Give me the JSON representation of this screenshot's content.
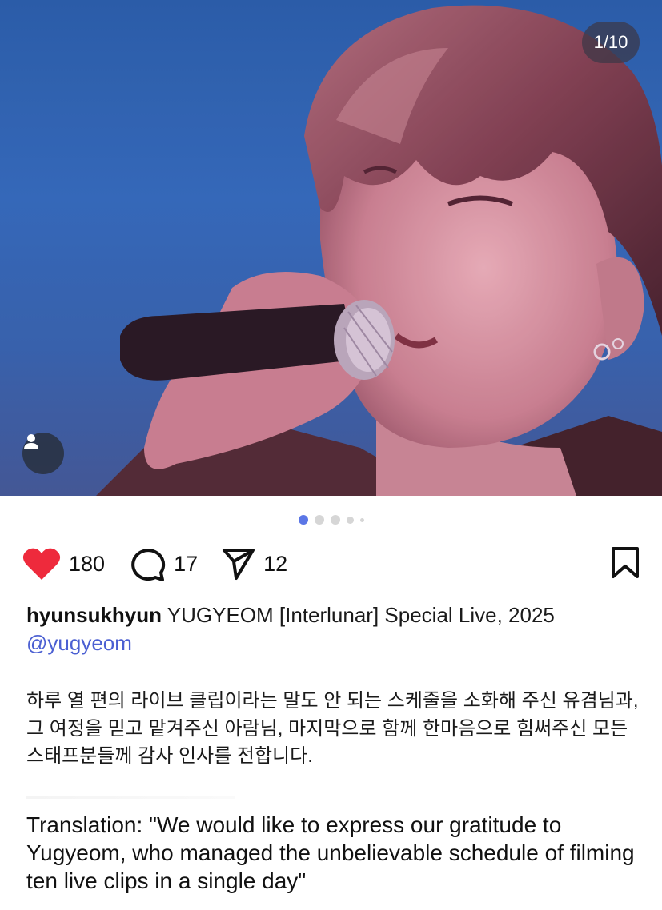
{
  "photo": {
    "description_icon": "user-icon",
    "counter": "1/10"
  },
  "pagination": {
    "active_index": 0,
    "total_dots": 5
  },
  "actions": {
    "likes": "180",
    "comments": "17",
    "shares": "12",
    "like_color": "#ee2a3c"
  },
  "caption": {
    "username": "hyunsukhyun",
    "text": " YUGYEOM [Interlunar] Special Live, 2025",
    "mention": "@yugyeom"
  },
  "body": {
    "korean": "하루 열 편의 라이브 클립이라는 말도 안 되는 스케줄을 소화해 주신 유겸님과, 그 여정을 믿고 맡겨주신 아람님, 마지막으로 함께 한마음으로 힘써주신 모든 스태프분들께 감사 인사를 전합니다.",
    "translation": "Translation: \"We would like to express our gratitude to Yugyeom, who managed the unbelievable schedule of filming ten live clips in a single day\""
  }
}
